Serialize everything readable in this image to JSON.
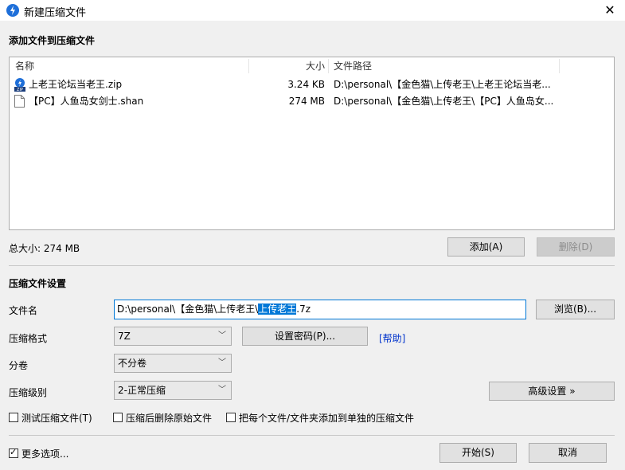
{
  "window": {
    "title": "新建压缩文件",
    "close_glyph": "✕"
  },
  "add_section": {
    "title": "添加文件到压缩文件"
  },
  "file_list": {
    "columns": [
      "名称",
      "大小",
      "文件路径"
    ],
    "rows": [
      {
        "name": "上老王论坛当老王.zip",
        "size": "3.24 KB",
        "path": "D:\\personal\\【金色猫\\上传老王\\上老王论坛当老...",
        "icon": "zip-file-icon"
      },
      {
        "name": "【PC】人鱼岛女剑士.shan",
        "size": "274 MB",
        "path": "D:\\personal\\【金色猫\\上传老王\\【PC】人鱼岛女...",
        "icon": "blank-file-icon"
      }
    ]
  },
  "total_size": "总大小: 274 MB",
  "buttons": {
    "add": "添加(A)",
    "delete": "删除(D)",
    "browse": "浏览(B)...",
    "set_password": "设置密码(P)...",
    "advanced": "高级设置 »",
    "start": "开始(S)",
    "cancel": "取消"
  },
  "settings": {
    "title": "压缩文件设置",
    "filename_label": "文件名",
    "filename_prefix": "D:\\personal\\【金色猫\\上传老王\\",
    "filename_selected": "上传老王",
    "filename_suffix": ".7z",
    "format_label": "压缩格式",
    "format_value": "7Z",
    "help_link": "[帮助]",
    "split_label": "分卷",
    "split_value": "不分卷",
    "level_label": "压缩级别",
    "level_value": "2-正常压缩"
  },
  "options": {
    "test": "测试压缩文件(T)",
    "delete_after": "压缩后删除原始文件",
    "separate": "把每个文件/文件夹添加到单独的压缩文件",
    "more": "更多选项..."
  },
  "colors": {
    "accent": "#0078d7",
    "link": "#0033cc"
  }
}
